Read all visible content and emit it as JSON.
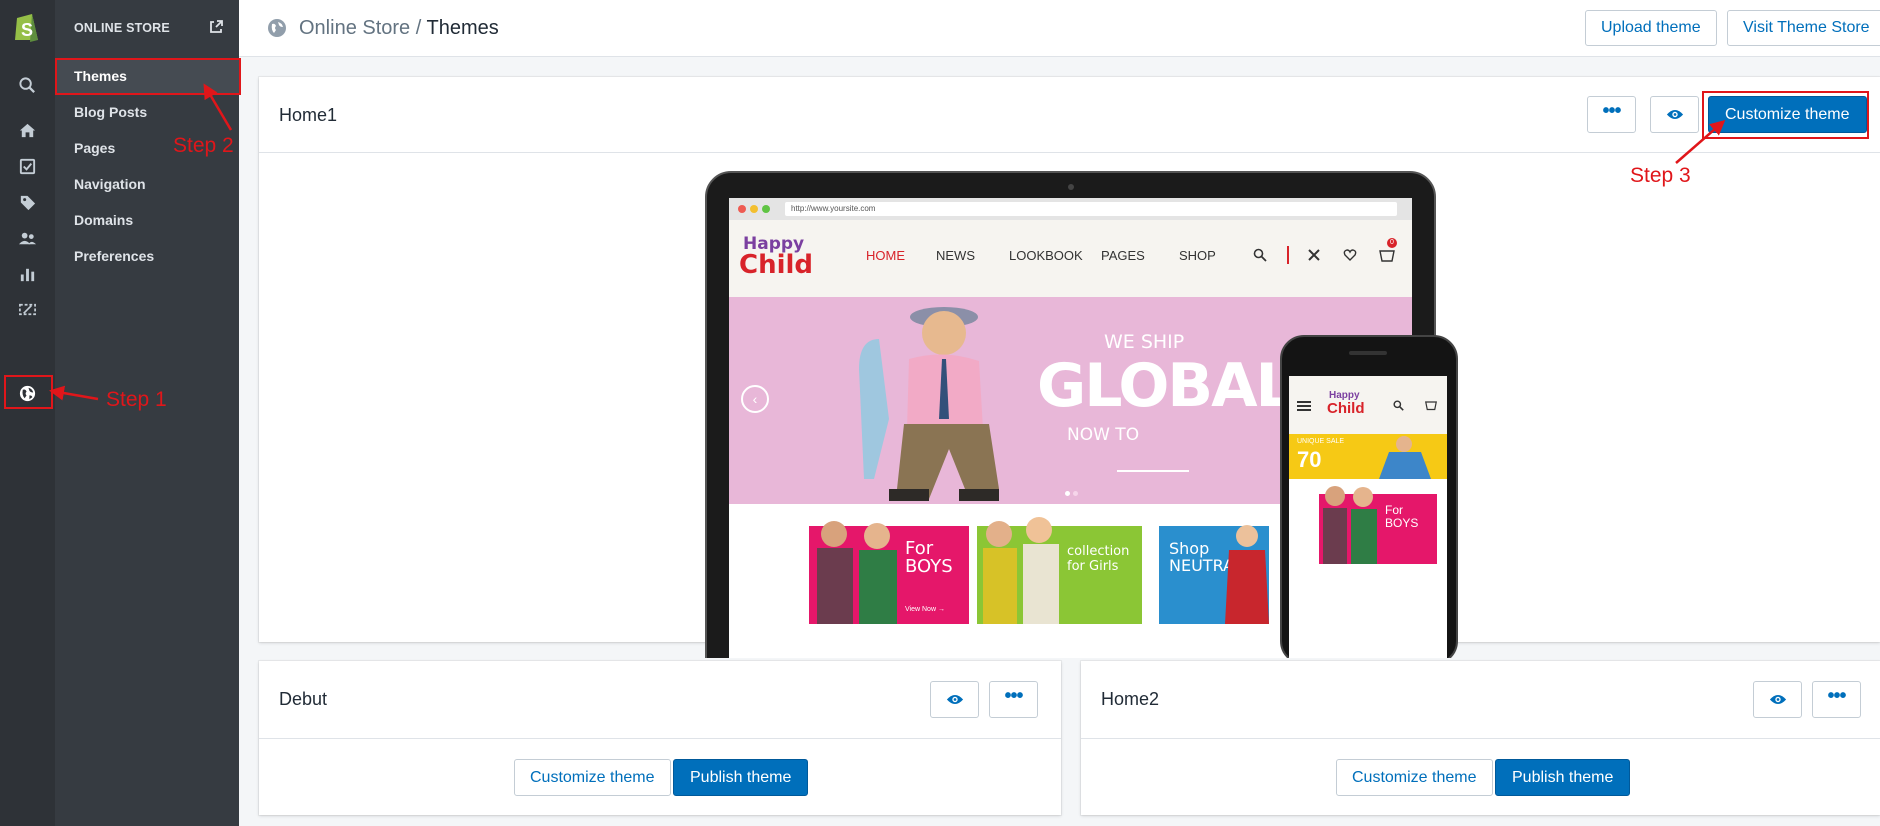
{
  "sidenav": {
    "title": "ONLINE STORE",
    "items": [
      {
        "label": "Themes",
        "active": true
      },
      {
        "label": "Blog Posts"
      },
      {
        "label": "Pages"
      },
      {
        "label": "Navigation"
      },
      {
        "label": "Domains"
      },
      {
        "label": "Preferences"
      }
    ]
  },
  "rail": {
    "icons": [
      "shopify-logo",
      "search-icon",
      "home-icon",
      "orders-icon",
      "tag-icon",
      "customers-icon",
      "analytics-icon",
      "discounts-icon",
      "online-store-icon"
    ]
  },
  "breadcrumb": {
    "parent": "Online Store",
    "separator": "/",
    "current": "Themes"
  },
  "topbar": {
    "upload_label": "Upload theme",
    "visit_label": "Visit Theme Store"
  },
  "current_theme": {
    "name": "Home1",
    "customize_label": "Customize theme",
    "preview": {
      "url": "http://www.yoursite.com",
      "menu": [
        "HOME",
        "NEWS",
        "LOOKBOOK",
        "PAGES",
        "SHOP"
      ],
      "brand_top": "Happy",
      "brand_bottom": "Child",
      "hero_small": "WE SHIP",
      "hero_big": "GLOBALLY!",
      "hero_sub": "NOW TO",
      "cat_boys": "For BOYS",
      "cat_girls": "collection for Girls",
      "cat_neutral": "Shop NEUTRAL",
      "view_now": "View Now →",
      "cart_count": "0",
      "phone_sale": "70",
      "phone_sale_label": "UNIQUE SALE"
    }
  },
  "library": [
    {
      "name": "Debut",
      "customize_label": "Customize theme",
      "publish_label": "Publish theme"
    },
    {
      "name": "Home2",
      "customize_label": "Customize theme",
      "publish_label": "Publish theme"
    }
  ],
  "annotations": {
    "step1": "Step 1",
    "step2": "Step 2",
    "step3": "Step 3"
  },
  "colors": {
    "accent": "#006fbb",
    "annotation": "#e0161a",
    "sidebar": "#363b41",
    "rail": "#2e3237",
    "hero_pink": "#e8b7d8"
  }
}
